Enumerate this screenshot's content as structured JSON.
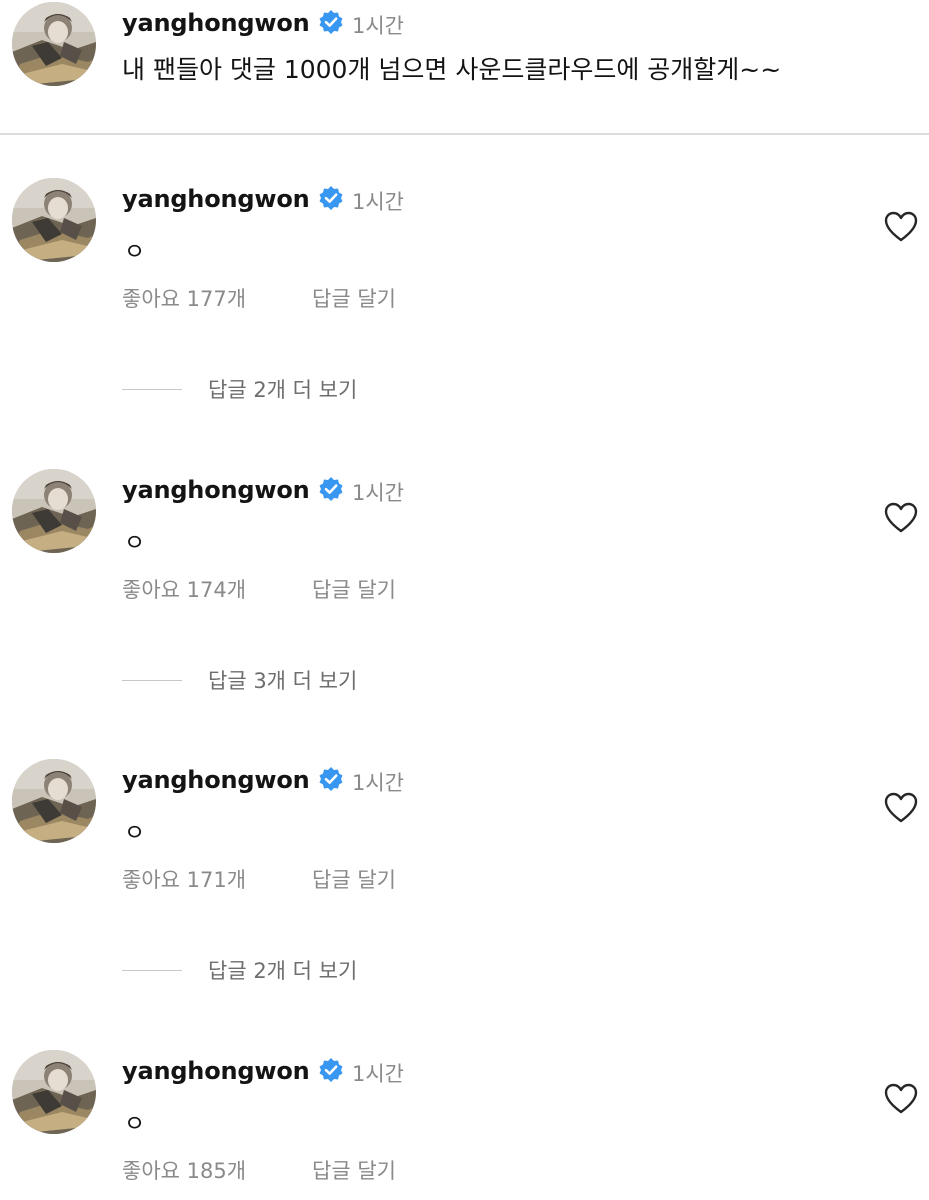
{
  "post": {
    "username": "yanghongwon",
    "time": "1시간",
    "caption": "내 팬들아 댓글 1000개 넘으면 사운드클라우드에 공개할게~~"
  },
  "comments": [
    {
      "username": "yanghongwon",
      "time": "1시간",
      "text": "ㅇ",
      "likes": "좋아요 177개",
      "reply": "답글 달기",
      "view_replies": "답글 2개 더 보기"
    },
    {
      "username": "yanghongwon",
      "time": "1시간",
      "text": "ㅇ",
      "likes": "좋아요 174개",
      "reply": "답글 달기",
      "view_replies": "답글 3개 더 보기"
    },
    {
      "username": "yanghongwon",
      "time": "1시간",
      "text": "ㅇ",
      "likes": "좋아요 171개",
      "reply": "답글 달기",
      "view_replies": "답글 2개 더 보기"
    },
    {
      "username": "yanghongwon",
      "time": "1시간",
      "text": "ㅇ",
      "likes": "좋아요 185개",
      "reply": "답글 달기"
    }
  ],
  "icons": {
    "verified": "verified-badge-icon",
    "like": "heart-icon"
  },
  "colors": {
    "verified_blue": "#3897f0",
    "secondary_text": "#8a8a8a",
    "primary_text": "#141414"
  }
}
